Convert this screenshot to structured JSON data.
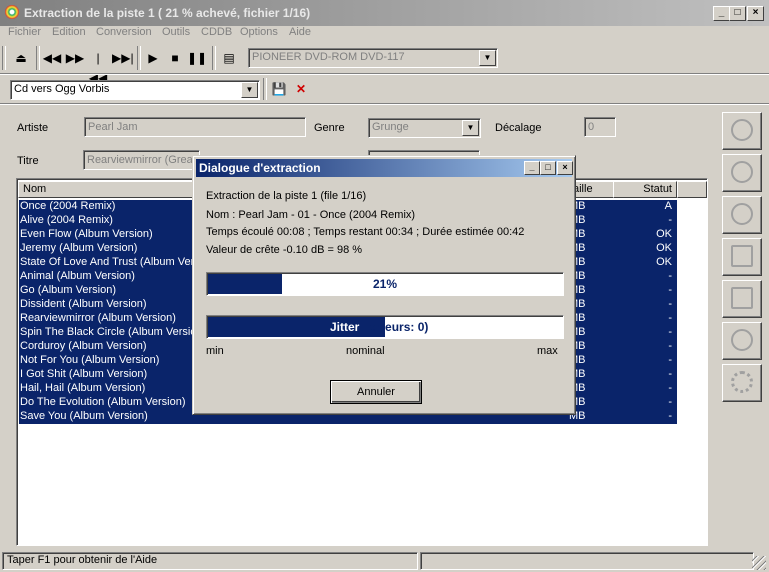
{
  "window": {
    "title": "Extraction de la piste 1 ( 21 % achevé, fichier 1/16)",
    "min": "_",
    "max": "□",
    "close": "×"
  },
  "menu": [
    "Fichier",
    "Edition",
    "Conversion",
    "Outils",
    "CDDB",
    "Options",
    "Aide"
  ],
  "toolbar": {
    "drive": "PIONEER DVD-ROM DVD-117",
    "profile": "Cd vers Ogg Vorbis"
  },
  "info": {
    "artist_label": "Artiste",
    "artist_value": "Pearl Jam",
    "genre_label": "Genre",
    "genre_value": "Grunge",
    "offset_label": "Décalage",
    "offset_value": "0",
    "title_label": "Titre",
    "title_value": "Rearviewmirror (Greate"
  },
  "list": {
    "columns": {
      "name": "Nom",
      "size": "aille",
      "status": "Statut"
    },
    "rows": [
      {
        "name": "Once (2004 Remix)",
        "size": "MB",
        "status": "A"
      },
      {
        "name": "Alive (2004 Remix)",
        "size": "MB",
        "status": "-"
      },
      {
        "name": "Even Flow (Album Version)",
        "size": "MB",
        "status": "OK"
      },
      {
        "name": "Jeremy (Album Version)",
        "size": "MB",
        "status": "OK"
      },
      {
        "name": "State Of Love And Trust (Album Vers",
        "size": "MB",
        "status": "OK"
      },
      {
        "name": "Animal (Album Version)",
        "size": "MB",
        "status": "-"
      },
      {
        "name": "Go (Album Version)",
        "size": "MB",
        "status": "-"
      },
      {
        "name": "Dissident (Album Version)",
        "size": "MB",
        "status": "-"
      },
      {
        "name": "Rearviewmirror (Album Version)",
        "size": "MB",
        "status": "-"
      },
      {
        "name": "Spin The Black Circle (Album Version",
        "size": "MB",
        "status": "-"
      },
      {
        "name": "Corduroy (Album Version)",
        "size": "MB",
        "status": "-"
      },
      {
        "name": "Not For You (Album Version)",
        "size": "MB",
        "status": "-"
      },
      {
        "name": "I Got Shit (Album Version)",
        "size": "MB",
        "status": "-"
      },
      {
        "name": "Hail, Hail (Album Version)",
        "size": "MB",
        "status": "-"
      },
      {
        "name": "Do The Evolution (Album Version)",
        "size": "MB",
        "status": "-"
      },
      {
        "name": "Save You (Album Version)",
        "size": "MB",
        "status": "-"
      }
    ]
  },
  "dialog": {
    "title": "Dialogue d'extraction",
    "line1": "Extraction de la piste 1 (file 1/16)",
    "line2": "Nom : Pearl Jam - 01 - Once (2004 Remix)",
    "line3": "Temps écoulé 00:08 ; Temps restant 00:34 ; Durée estimée 00:42",
    "line4": "Valeur de crête -0.10 dB =  98 %",
    "progress_label": "21%",
    "progress": 0.21,
    "jitter_label": "Jitter",
    "jitter_rest": "erreurs: 0)",
    "jitter_level": 0.5,
    "scale_min": "min",
    "scale_nominal": "nominal",
    "scale_max": "max",
    "cancel": "Annuler"
  },
  "statusbar": {
    "text": "Taper F1 pour obtenir de l'Aide"
  }
}
